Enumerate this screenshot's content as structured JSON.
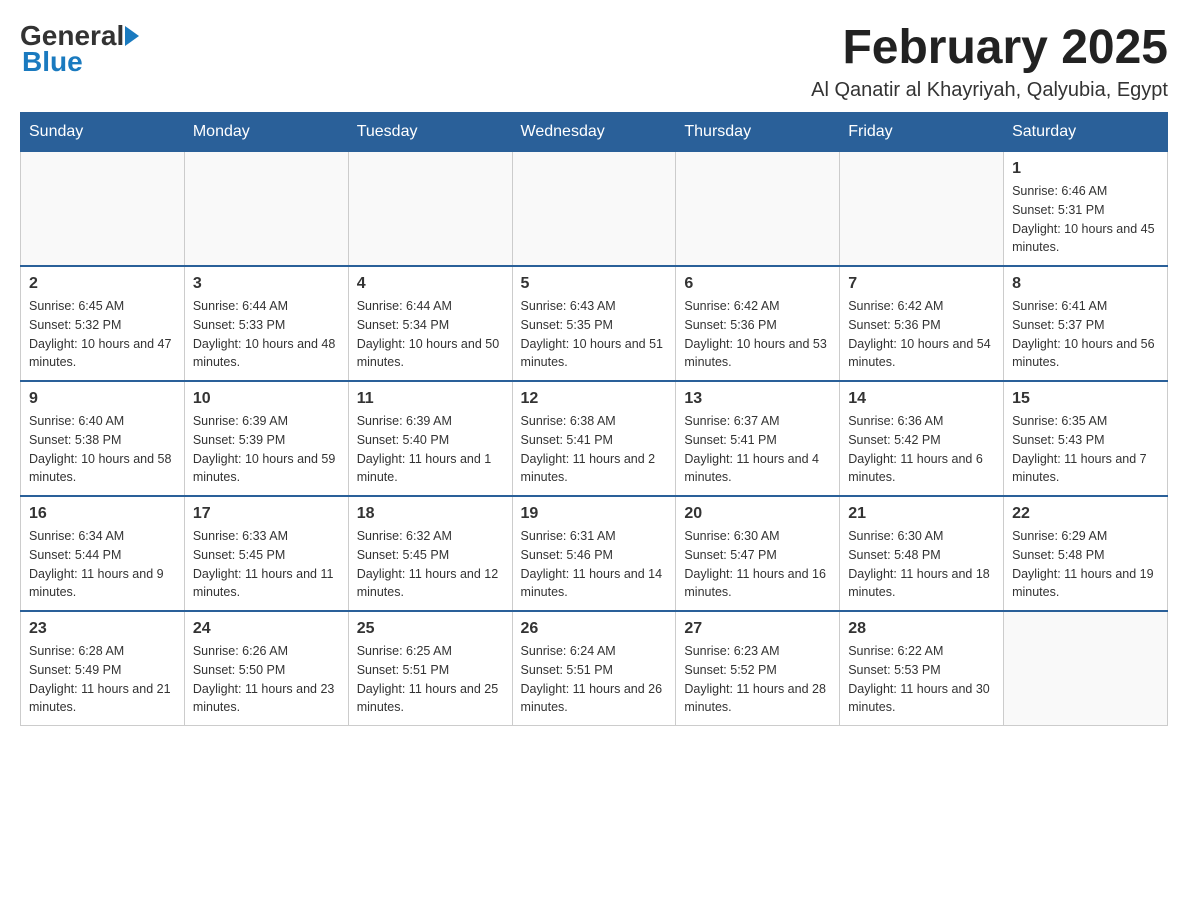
{
  "header": {
    "logo_general": "General",
    "logo_blue": "Blue",
    "title": "February 2025",
    "subtitle": "Al Qanatir al Khayriyah, Qalyubia, Egypt"
  },
  "days_header": [
    "Sunday",
    "Monday",
    "Tuesday",
    "Wednesday",
    "Thursday",
    "Friday",
    "Saturday"
  ],
  "weeks": [
    {
      "cells": [
        {
          "day": "",
          "sunrise": "",
          "sunset": "",
          "daylight": ""
        },
        {
          "day": "",
          "sunrise": "",
          "sunset": "",
          "daylight": ""
        },
        {
          "day": "",
          "sunrise": "",
          "sunset": "",
          "daylight": ""
        },
        {
          "day": "",
          "sunrise": "",
          "sunset": "",
          "daylight": ""
        },
        {
          "day": "",
          "sunrise": "",
          "sunset": "",
          "daylight": ""
        },
        {
          "day": "",
          "sunrise": "",
          "sunset": "",
          "daylight": ""
        },
        {
          "day": "1",
          "sunrise": "Sunrise: 6:46 AM",
          "sunset": "Sunset: 5:31 PM",
          "daylight": "Daylight: 10 hours and 45 minutes."
        }
      ]
    },
    {
      "cells": [
        {
          "day": "2",
          "sunrise": "Sunrise: 6:45 AM",
          "sunset": "Sunset: 5:32 PM",
          "daylight": "Daylight: 10 hours and 47 minutes."
        },
        {
          "day": "3",
          "sunrise": "Sunrise: 6:44 AM",
          "sunset": "Sunset: 5:33 PM",
          "daylight": "Daylight: 10 hours and 48 minutes."
        },
        {
          "day": "4",
          "sunrise": "Sunrise: 6:44 AM",
          "sunset": "Sunset: 5:34 PM",
          "daylight": "Daylight: 10 hours and 50 minutes."
        },
        {
          "day": "5",
          "sunrise": "Sunrise: 6:43 AM",
          "sunset": "Sunset: 5:35 PM",
          "daylight": "Daylight: 10 hours and 51 minutes."
        },
        {
          "day": "6",
          "sunrise": "Sunrise: 6:42 AM",
          "sunset": "Sunset: 5:36 PM",
          "daylight": "Daylight: 10 hours and 53 minutes."
        },
        {
          "day": "7",
          "sunrise": "Sunrise: 6:42 AM",
          "sunset": "Sunset: 5:36 PM",
          "daylight": "Daylight: 10 hours and 54 minutes."
        },
        {
          "day": "8",
          "sunrise": "Sunrise: 6:41 AM",
          "sunset": "Sunset: 5:37 PM",
          "daylight": "Daylight: 10 hours and 56 minutes."
        }
      ]
    },
    {
      "cells": [
        {
          "day": "9",
          "sunrise": "Sunrise: 6:40 AM",
          "sunset": "Sunset: 5:38 PM",
          "daylight": "Daylight: 10 hours and 58 minutes."
        },
        {
          "day": "10",
          "sunrise": "Sunrise: 6:39 AM",
          "sunset": "Sunset: 5:39 PM",
          "daylight": "Daylight: 10 hours and 59 minutes."
        },
        {
          "day": "11",
          "sunrise": "Sunrise: 6:39 AM",
          "sunset": "Sunset: 5:40 PM",
          "daylight": "Daylight: 11 hours and 1 minute."
        },
        {
          "day": "12",
          "sunrise": "Sunrise: 6:38 AM",
          "sunset": "Sunset: 5:41 PM",
          "daylight": "Daylight: 11 hours and 2 minutes."
        },
        {
          "day": "13",
          "sunrise": "Sunrise: 6:37 AM",
          "sunset": "Sunset: 5:41 PM",
          "daylight": "Daylight: 11 hours and 4 minutes."
        },
        {
          "day": "14",
          "sunrise": "Sunrise: 6:36 AM",
          "sunset": "Sunset: 5:42 PM",
          "daylight": "Daylight: 11 hours and 6 minutes."
        },
        {
          "day": "15",
          "sunrise": "Sunrise: 6:35 AM",
          "sunset": "Sunset: 5:43 PM",
          "daylight": "Daylight: 11 hours and 7 minutes."
        }
      ]
    },
    {
      "cells": [
        {
          "day": "16",
          "sunrise": "Sunrise: 6:34 AM",
          "sunset": "Sunset: 5:44 PM",
          "daylight": "Daylight: 11 hours and 9 minutes."
        },
        {
          "day": "17",
          "sunrise": "Sunrise: 6:33 AM",
          "sunset": "Sunset: 5:45 PM",
          "daylight": "Daylight: 11 hours and 11 minutes."
        },
        {
          "day": "18",
          "sunrise": "Sunrise: 6:32 AM",
          "sunset": "Sunset: 5:45 PM",
          "daylight": "Daylight: 11 hours and 12 minutes."
        },
        {
          "day": "19",
          "sunrise": "Sunrise: 6:31 AM",
          "sunset": "Sunset: 5:46 PM",
          "daylight": "Daylight: 11 hours and 14 minutes."
        },
        {
          "day": "20",
          "sunrise": "Sunrise: 6:30 AM",
          "sunset": "Sunset: 5:47 PM",
          "daylight": "Daylight: 11 hours and 16 minutes."
        },
        {
          "day": "21",
          "sunrise": "Sunrise: 6:30 AM",
          "sunset": "Sunset: 5:48 PM",
          "daylight": "Daylight: 11 hours and 18 minutes."
        },
        {
          "day": "22",
          "sunrise": "Sunrise: 6:29 AM",
          "sunset": "Sunset: 5:48 PM",
          "daylight": "Daylight: 11 hours and 19 minutes."
        }
      ]
    },
    {
      "cells": [
        {
          "day": "23",
          "sunrise": "Sunrise: 6:28 AM",
          "sunset": "Sunset: 5:49 PM",
          "daylight": "Daylight: 11 hours and 21 minutes."
        },
        {
          "day": "24",
          "sunrise": "Sunrise: 6:26 AM",
          "sunset": "Sunset: 5:50 PM",
          "daylight": "Daylight: 11 hours and 23 minutes."
        },
        {
          "day": "25",
          "sunrise": "Sunrise: 6:25 AM",
          "sunset": "Sunset: 5:51 PM",
          "daylight": "Daylight: 11 hours and 25 minutes."
        },
        {
          "day": "26",
          "sunrise": "Sunrise: 6:24 AM",
          "sunset": "Sunset: 5:51 PM",
          "daylight": "Daylight: 11 hours and 26 minutes."
        },
        {
          "day": "27",
          "sunrise": "Sunrise: 6:23 AM",
          "sunset": "Sunset: 5:52 PM",
          "daylight": "Daylight: 11 hours and 28 minutes."
        },
        {
          "day": "28",
          "sunrise": "Sunrise: 6:22 AM",
          "sunset": "Sunset: 5:53 PM",
          "daylight": "Daylight: 11 hours and 30 minutes."
        },
        {
          "day": "",
          "sunrise": "",
          "sunset": "",
          "daylight": ""
        }
      ]
    }
  ]
}
